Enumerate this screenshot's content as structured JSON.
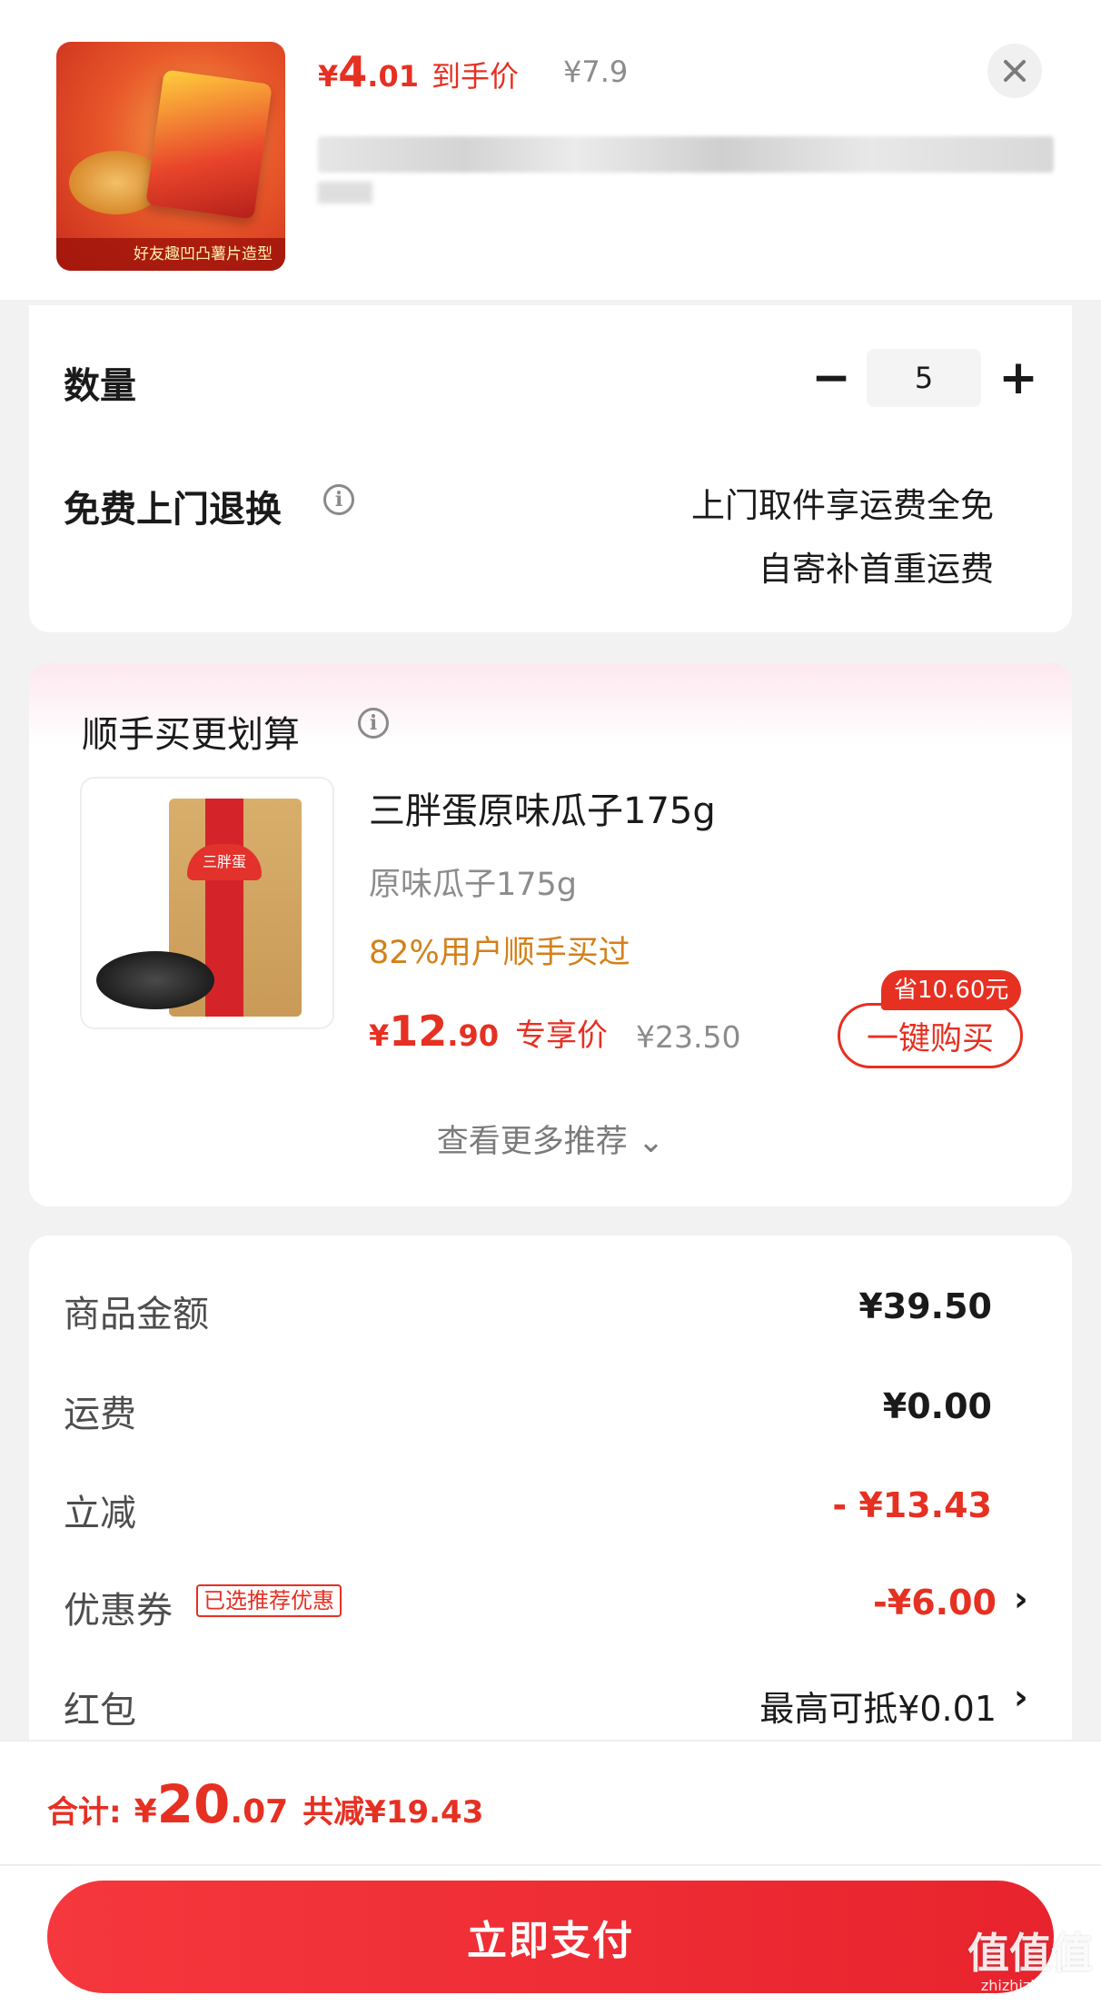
{
  "header": {
    "thumb_caption": "好友趣凹凸薯片造型",
    "price_currency": "¥",
    "price_int": "4",
    "price_dec": ".01",
    "price_tag": "到手价",
    "original_price": "¥7.9",
    "close_icon": "close-icon"
  },
  "quantity": {
    "label": "数量",
    "value": "5",
    "minus_label": "−",
    "plus_label": "+"
  },
  "returns": {
    "label": "免费上门退换",
    "info_icon": "info-icon",
    "line1": "上门取件享运费全免",
    "line2": "自寄补首重运费"
  },
  "upsell": {
    "section_title": "顺手买更划算",
    "product_logo_text": "三胖蛋",
    "product_title": "三胖蛋原味瓜子175g",
    "product_spec": "原味瓜子175g",
    "social_hint": "82%用户顺手买过",
    "price_currency": "¥",
    "price_int": "12",
    "price_dec": ".90",
    "price_tag": "专享价",
    "original_price": "¥23.50",
    "save_badge": "省10.60元",
    "buy_button": "一键购买",
    "more_link": "查看更多推荐 ⌄"
  },
  "summary": {
    "rows": [
      {
        "label": "商品金额",
        "value": "¥39.50"
      },
      {
        "label": "运费",
        "value": "¥0.00"
      },
      {
        "label": "立减",
        "value": "- ¥13.43"
      },
      {
        "label": "优惠券",
        "tag": "已选推荐优惠",
        "value": "-¥6.00",
        "chevron": "›"
      },
      {
        "label": "红包",
        "value": "最高可抵¥0.01",
        "chevron": "›"
      }
    ]
  },
  "footer": {
    "total_label": "合计:",
    "total_currency": "¥",
    "total_int": "20",
    "total_dec": ".07",
    "total_saved": "共减¥19.43",
    "pay_button": "立即支付"
  },
  "watermark": {
    "main": "值值值",
    "sub": "zhizhizhi.com"
  },
  "colors": {
    "accent_red": "#e63022",
    "hint_orange": "#d4801a",
    "muted_gray": "#8c8c8c"
  }
}
